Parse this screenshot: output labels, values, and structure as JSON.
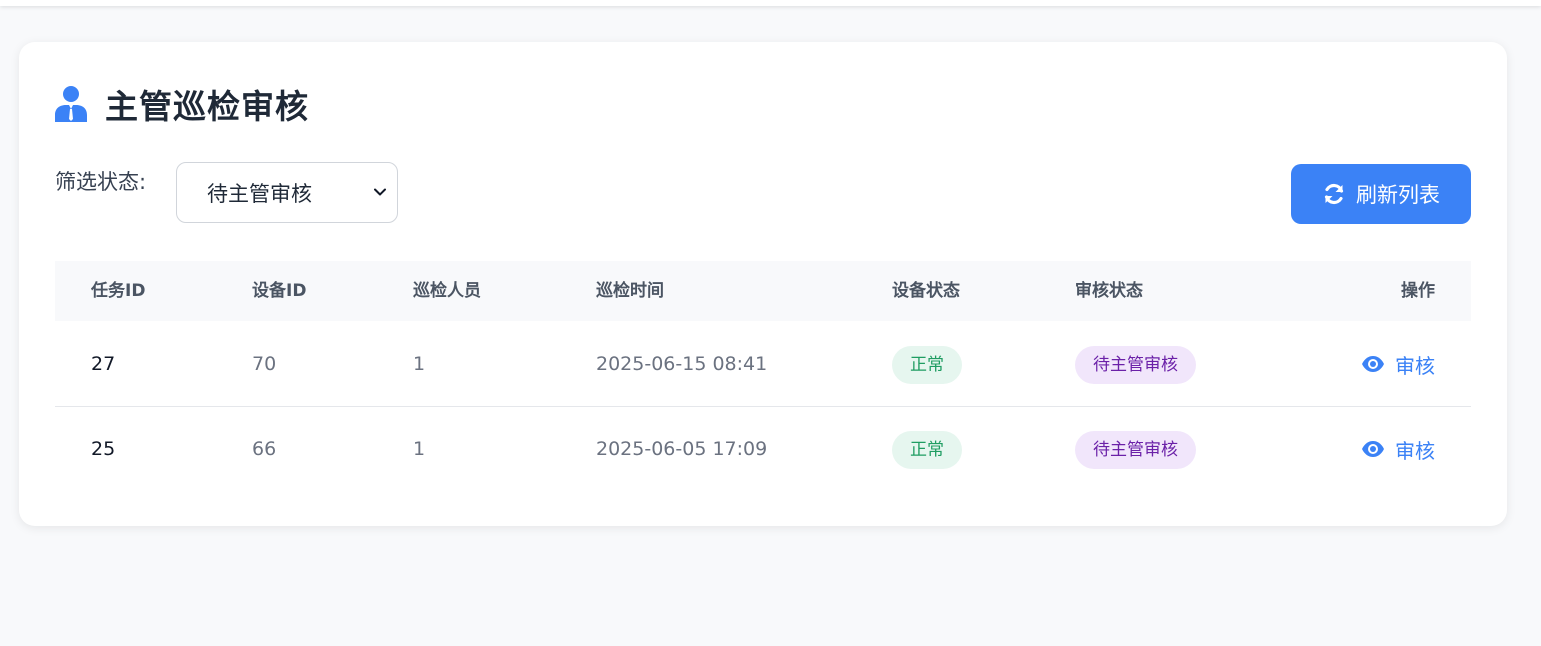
{
  "page": {
    "title": "主管巡检审核",
    "title_icon": "user-tie-icon",
    "accent_color": "#3b82f6"
  },
  "filter": {
    "label": "筛选状态:",
    "selected": "待主管审核"
  },
  "toolbar": {
    "refresh_label": "刷新列表",
    "refresh_icon": "sync-icon"
  },
  "table": {
    "headers": [
      "任务ID",
      "设备ID",
      "巡检人员",
      "巡检时间",
      "设备状态",
      "审核状态",
      "操作"
    ],
    "rows": [
      {
        "task_id": "27",
        "device_id": "70",
        "inspector": "1",
        "time": "2025-06-15 08:41",
        "device_status": "正常",
        "review_status": "待主管审核",
        "action": "审核"
      },
      {
        "task_id": "25",
        "device_id": "66",
        "inspector": "1",
        "time": "2025-06-05 17:09",
        "device_status": "正常",
        "review_status": "待主管审核",
        "action": "审核"
      }
    ]
  },
  "colors": {
    "ok_badge_bg": "#e6f6ef",
    "ok_badge_text": "#1f9d62",
    "pending_badge_bg": "#f1e6fb",
    "pending_badge_text": "#6b21a8"
  }
}
